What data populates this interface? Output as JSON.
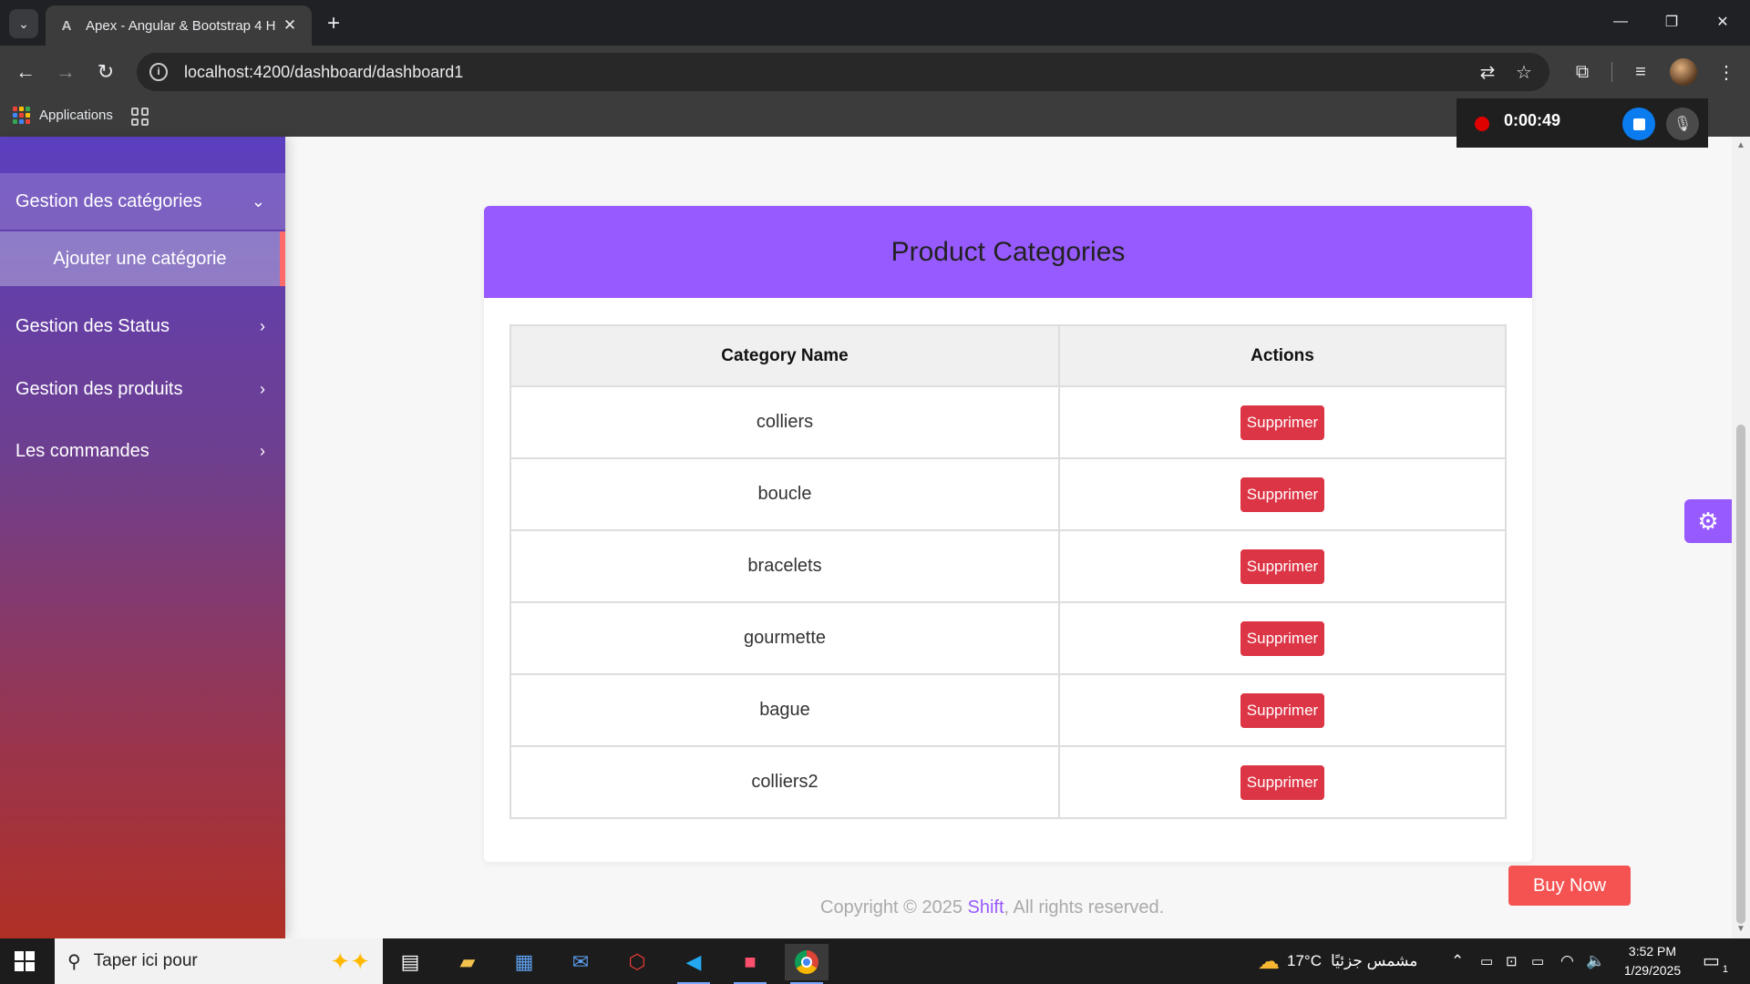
{
  "browser": {
    "tab_title": "Apex - Angular & Bootstrap 4 H",
    "url": "localhost:4200/dashboard/dashboard1",
    "bookmark_apps": "Applications"
  },
  "recorder": {
    "time": "0:00:49"
  },
  "sidebar": {
    "items": [
      {
        "label": "Gestion des catégories",
        "chevron": "⌄"
      },
      {
        "label": "Gestion des Status",
        "chevron": "›"
      },
      {
        "label": "Gestion des produits",
        "chevron": "›"
      },
      {
        "label": "Les commandes",
        "chevron": "›"
      }
    ],
    "sub_item": "Ajouter une catégorie"
  },
  "card": {
    "title": "Product Categories",
    "columns": [
      "Category Name",
      "Actions"
    ],
    "rows": [
      {
        "name": "colliers",
        "action": "Supprimer"
      },
      {
        "name": "boucle",
        "action": "Supprimer"
      },
      {
        "name": "bracelets",
        "action": "Supprimer"
      },
      {
        "name": "gourmette",
        "action": "Supprimer"
      },
      {
        "name": "bague",
        "action": "Supprimer"
      },
      {
        "name": "colliers2",
        "action": "Supprimer"
      }
    ]
  },
  "buy_now": "Buy Now",
  "footer": {
    "prefix": "Copyright © 2025 ",
    "brand": "Shift",
    "suffix": ", All rights reserved."
  },
  "taskbar": {
    "search_placeholder": "Taper ici pour",
    "weather_temp": "17°C",
    "weather_text": "مشمس جزئيًا",
    "time": "3:52 PM",
    "date": "1/29/2025",
    "notif_count": "1"
  },
  "colors": {
    "accent": "#975aff",
    "danger": "#dc3545",
    "buy_now": "#f55252"
  }
}
